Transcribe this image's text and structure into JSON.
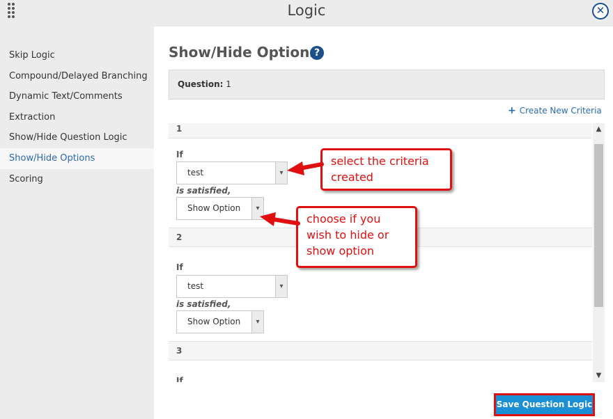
{
  "dialog": {
    "title": "Logic"
  },
  "sidebar": {
    "items": [
      {
        "label": "Skip Logic",
        "active": false
      },
      {
        "label": "Compound/Delayed Branching",
        "active": false
      },
      {
        "label": "Dynamic Text/Comments",
        "active": false
      },
      {
        "label": "Extraction",
        "active": false
      },
      {
        "label": "Show/Hide Question Logic",
        "active": false
      },
      {
        "label": "Show/Hide Options",
        "active": true
      },
      {
        "label": "Scoring",
        "active": false
      }
    ]
  },
  "main": {
    "title": "Show/Hide Options",
    "help_symbol": "?",
    "question_label": "Question:",
    "question_value": "1",
    "create_link": "Create New Criteria",
    "criteria": [
      {
        "number": "1",
        "if_label": "If",
        "criteria_value": "test",
        "satisfied_label": "is satisfied,",
        "action_value": "Show Option"
      },
      {
        "number": "2",
        "if_label": "If",
        "criteria_value": "test",
        "satisfied_label": "is satisfied,",
        "action_value": "Show Option"
      },
      {
        "number": "3",
        "if_label": "If",
        "criteria_value": "",
        "satisfied_label": "",
        "action_value": ""
      }
    ],
    "save_button": "Save Question Logic"
  },
  "annotations": {
    "callout_1": "select the criteria created",
    "callout_2": "choose if you wish to hide or show option"
  },
  "colors": {
    "accent": "#1a4f8b",
    "link": "#2a6ab1",
    "annotation": "#e01010",
    "save_button": "#1a8fd6"
  }
}
